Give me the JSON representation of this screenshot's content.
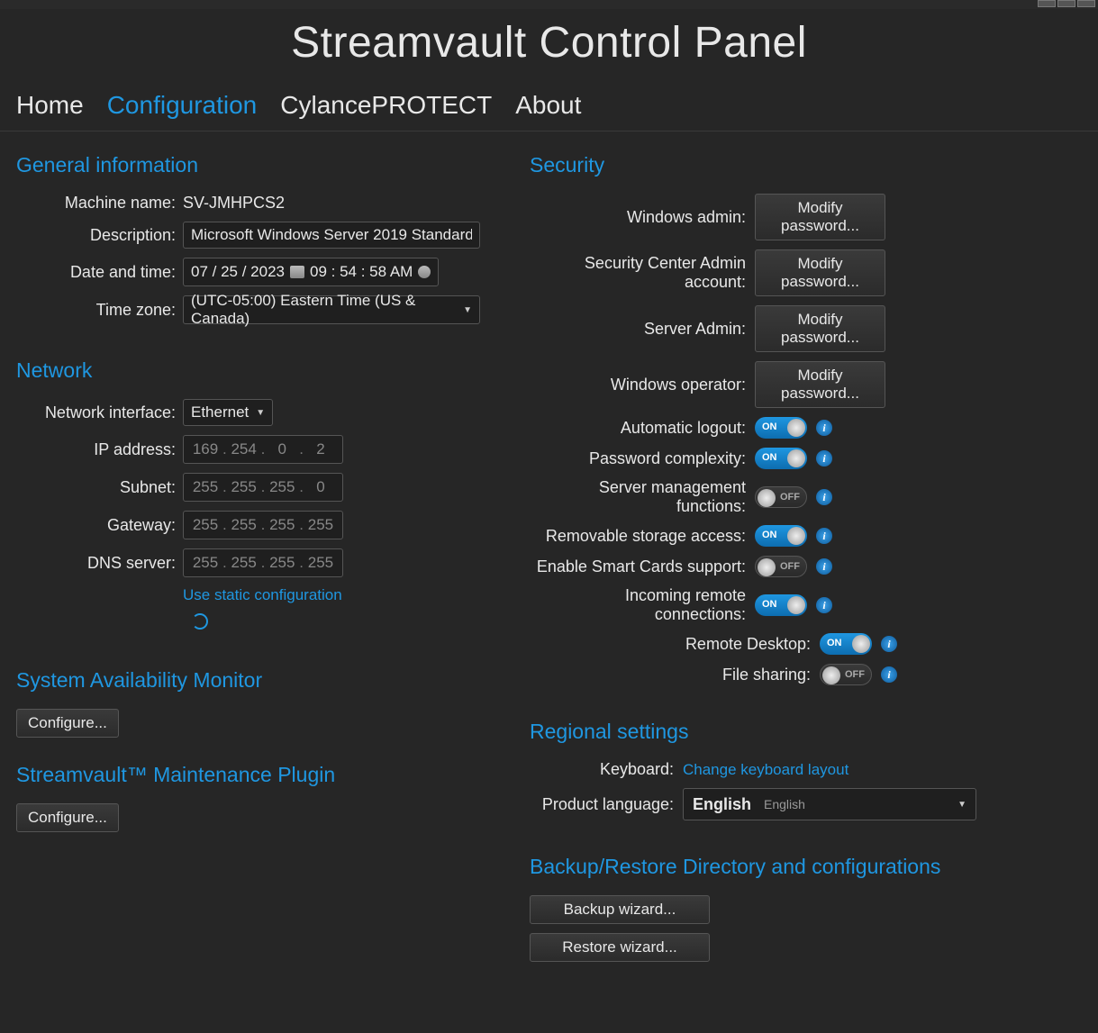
{
  "app_title": "Streamvault Control Panel",
  "nav": {
    "home": "Home",
    "configuration": "Configuration",
    "cylance": "CylancePROTECT",
    "about": "About"
  },
  "general": {
    "title": "General information",
    "machine_name_label": "Machine name:",
    "machine_name": "SV-JMHPCS2",
    "description_label": "Description:",
    "description": "Microsoft Windows Server 2019 Standard",
    "datetime_label": "Date and time:",
    "date": "07 / 25 / 2023",
    "time": "09 : 54 : 58 AM",
    "timezone_label": "Time zone:",
    "timezone": "(UTC-05:00) Eastern Time (US & Canada)"
  },
  "network": {
    "title": "Network",
    "interface_label": "Network interface:",
    "interface": "Ethernet",
    "ip_label": "IP address:",
    "ip": [
      "169",
      "254",
      "0",
      "2"
    ],
    "subnet_label": "Subnet:",
    "subnet": [
      "255",
      "255",
      "255",
      "0"
    ],
    "gateway_label": "Gateway:",
    "gateway": [
      "255",
      "255",
      "255",
      "255"
    ],
    "dns_label": "DNS server:",
    "dns": [
      "255",
      "255",
      "255",
      "255"
    ],
    "static_link": "Use static configuration"
  },
  "sam": {
    "title": "System Availability Monitor",
    "configure": "Configure..."
  },
  "maint": {
    "title": "Streamvault™ Maintenance Plugin",
    "configure": "Configure..."
  },
  "security": {
    "title": "Security",
    "windows_admin": "Windows admin:",
    "sc_admin": "Security Center Admin account:",
    "server_admin": "Server Admin:",
    "windows_operator": "Windows operator:",
    "modify_password": "Modify password...",
    "auto_logout": "Automatic logout:",
    "pw_complexity": "Password complexity:",
    "server_mgmt": "Server management functions:",
    "removable": "Removable storage access:",
    "smartcards": "Enable Smart Cards support:",
    "incoming": "Incoming remote connections:",
    "remote_desktop": "Remote Desktop:",
    "file_sharing": "File sharing:",
    "on_label": "ON",
    "off_label": "OFF",
    "toggles": {
      "auto_logout": "on",
      "pw_complexity": "on",
      "server_mgmt": "off",
      "removable": "on",
      "smartcards": "off",
      "incoming": "on",
      "remote_desktop": "on",
      "file_sharing": "off"
    }
  },
  "regional": {
    "title": "Regional settings",
    "keyboard_label": "Keyboard:",
    "keyboard_link": "Change keyboard layout",
    "lang_label": "Product language:",
    "lang_primary": "English",
    "lang_secondary": "English"
  },
  "backup": {
    "title": "Backup/Restore Directory and configurations",
    "backup_btn": "Backup wizard...",
    "restore_btn": "Restore wizard..."
  }
}
